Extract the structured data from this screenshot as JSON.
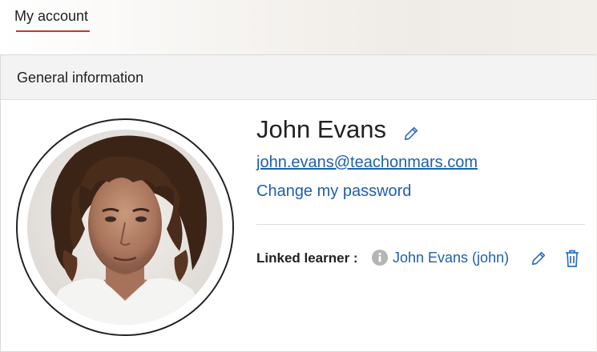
{
  "tabs": {
    "my_account": "My account"
  },
  "card": {
    "header_title": "General information"
  },
  "profile": {
    "name": "John Evans",
    "email": "john.evans@teachonmars.com",
    "change_password": "Change my password",
    "avatar_icon": "user-photo"
  },
  "linked_learner": {
    "label": "Linked learner :",
    "value": "John Evans (john)",
    "info_icon": "info-icon",
    "edit_icon": "pencil-icon",
    "delete_icon": "trash-icon"
  },
  "colors": {
    "accent_underline": "#c0392b",
    "link": "#1f5fb0",
    "icon_blue": "#2f6fc0",
    "info_grey": "#b5b5b5"
  }
}
